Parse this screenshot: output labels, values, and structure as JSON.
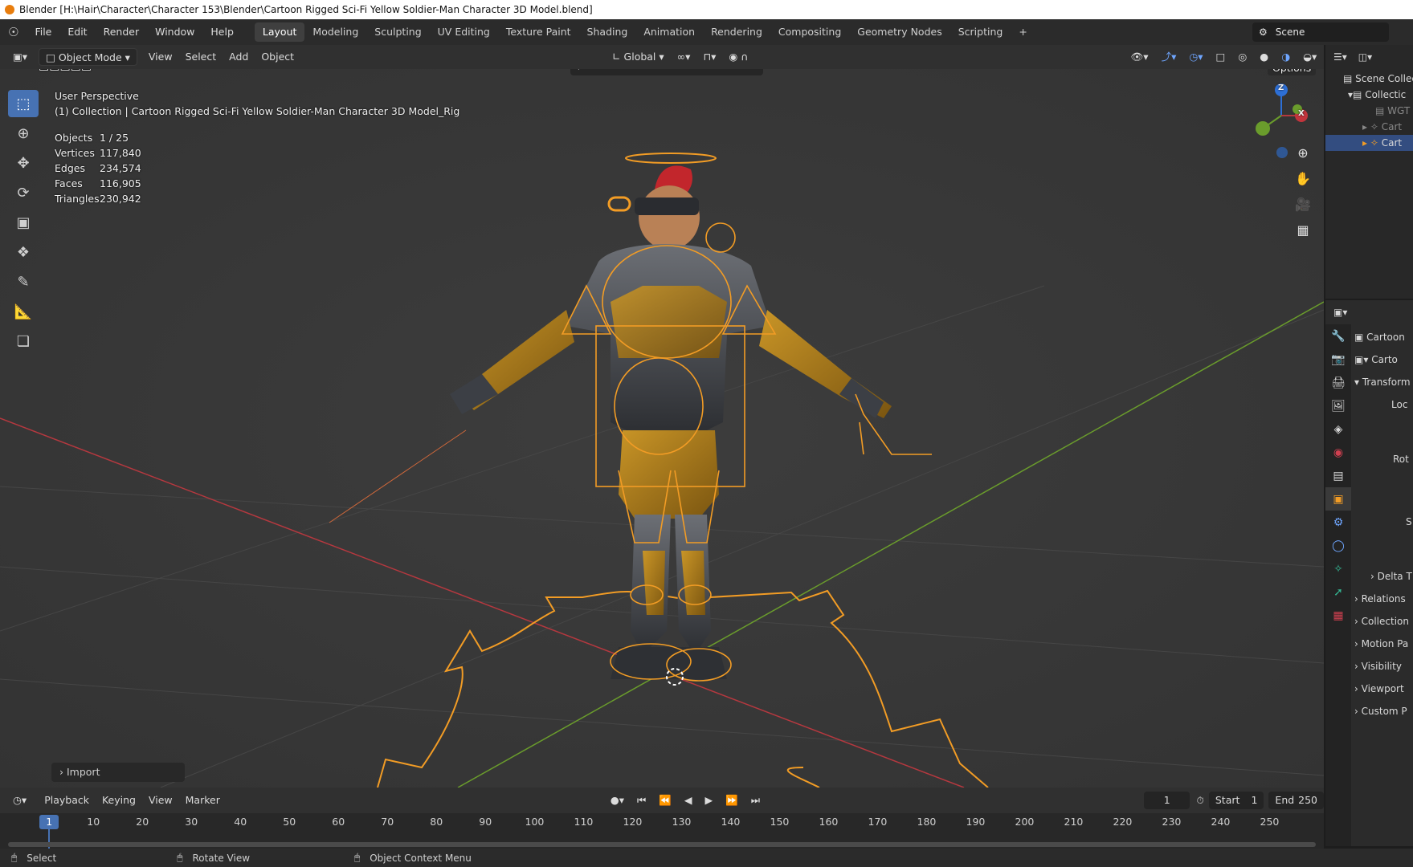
{
  "window": {
    "title": "Blender [H:\\Hair\\Character\\Character 153\\Blender\\Cartoon Rigged Sci-Fi Yellow Soldier-Man Character 3D Model.blend]"
  },
  "menu": {
    "items": [
      "File",
      "Edit",
      "Render",
      "Window",
      "Help"
    ],
    "workspaces": [
      "Layout",
      "Modeling",
      "Sculpting",
      "UV Editing",
      "Texture Paint",
      "Shading",
      "Animation",
      "Rendering",
      "Compositing",
      "Geometry Nodes",
      "Scripting",
      "+"
    ],
    "active_workspace": "Layout",
    "scene": "Scene"
  },
  "viewport_header": {
    "mode": "Object Mode",
    "menus": [
      "View",
      "Select",
      "Add",
      "Object"
    ],
    "orientation": "Global",
    "options": "Options"
  },
  "viewport": {
    "perspective": "User Perspective",
    "collection_line": "(1) Collection | Cartoon Rigged Sci-Fi Yellow Soldier-Man Character 3D Model_Rig",
    "stats": [
      {
        "label": "Objects",
        "value": "1 / 25"
      },
      {
        "label": "Vertices",
        "value": "117,840"
      },
      {
        "label": "Edges",
        "value": "234,574"
      },
      {
        "label": "Faces",
        "value": "116,905"
      },
      {
        "label": "Triangles",
        "value": "230,942"
      }
    ],
    "gizmo_labels": {
      "z": "Z",
      "x": "X"
    },
    "import_panel": "Import"
  },
  "outliner": {
    "items": [
      "Scene Collec",
      "Collectic",
      "WGT",
      "Cart",
      "Cart"
    ]
  },
  "properties": {
    "object_name": "Cartoon",
    "data_name": "Carto",
    "transform": "Transform",
    "location_label": "Loc",
    "rotation_label": "Rot",
    "scale_label": "S",
    "sections": [
      "Delta T",
      "Relations",
      "Collection",
      "Motion Pa",
      "Visibility",
      "Viewport",
      "Custom P"
    ]
  },
  "timeline": {
    "menus": [
      "Playback",
      "Keying",
      "View",
      "Marker"
    ],
    "current_frame": "1",
    "start_label": "Start",
    "start": "1",
    "end_label": "End",
    "end": "250",
    "ticks": [
      "1",
      "10",
      "20",
      "30",
      "40",
      "50",
      "60",
      "70",
      "80",
      "90",
      "100",
      "110",
      "120",
      "130",
      "140",
      "150",
      "160",
      "170",
      "180",
      "190",
      "200",
      "210",
      "220",
      "230",
      "240",
      "250"
    ]
  },
  "statusbar": {
    "select": "Select",
    "rotate": "Rotate View",
    "context": "Object Context Menu"
  },
  "colors": {
    "accent": "#4772b3",
    "selection": "#f29c25",
    "x_axis": "#b5383f",
    "y_axis": "#6a9c2c",
    "z_axis": "#2d6fd6"
  }
}
